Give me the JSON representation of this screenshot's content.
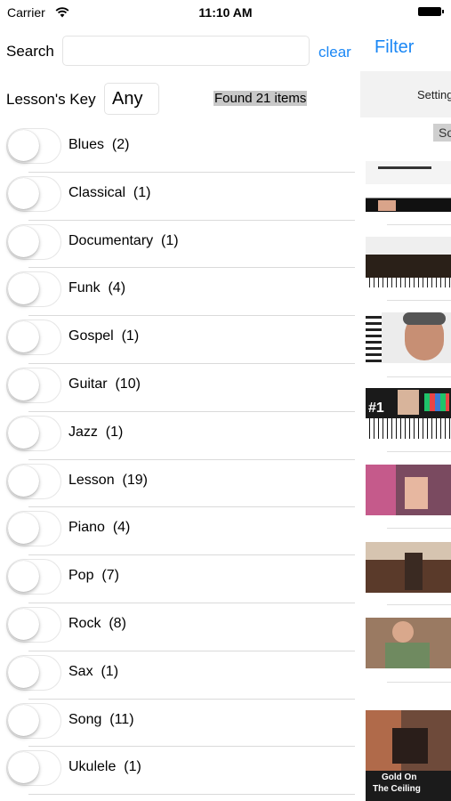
{
  "status_bar": {
    "carrier": "Carrier",
    "time": "11:10 AM"
  },
  "search": {
    "label": "Search",
    "value": "",
    "placeholder": "",
    "clear_label": "clear"
  },
  "key": {
    "label": "Lesson's Key",
    "value": "Any"
  },
  "found_text": "Found 21 items",
  "categories": [
    {
      "label": "Blues  (2)",
      "on": false
    },
    {
      "label": "Classical  (1)",
      "on": false
    },
    {
      "label": "Documentary  (1)",
      "on": false
    },
    {
      "label": "Funk  (4)",
      "on": false
    },
    {
      "label": "Gospel  (1)",
      "on": false
    },
    {
      "label": "Guitar  (10)",
      "on": false
    },
    {
      "label": "Jazz  (1)",
      "on": false
    },
    {
      "label": "Lesson  (19)",
      "on": false
    },
    {
      "label": "Piano  (4)",
      "on": false
    },
    {
      "label": "Pop  (7)",
      "on": false
    },
    {
      "label": "Rock  (8)",
      "on": false
    },
    {
      "label": "Sax  (1)",
      "on": false
    },
    {
      "label": "Song  (11)",
      "on": false
    },
    {
      "label": "Ukulele  (1)",
      "on": false
    }
  ],
  "background_view": {
    "filter_label": "Filter",
    "settings_label": "Settings",
    "sort_label": "Sort",
    "thumbnails": [
      {
        "kind": "piano-lesson"
      },
      {
        "kind": "piano-podcast"
      },
      {
        "kind": "man-with-keyboard"
      },
      {
        "kind": "piano-number-one"
      },
      {
        "kind": "guitar-player-pink"
      },
      {
        "kind": "guitar-player-room"
      },
      {
        "kind": "guitar-player-sofa"
      },
      {
        "kind": "guitar-player-red"
      },
      {
        "kind": "gold-on-the-ceiling"
      }
    ],
    "thumbnail_texts": {
      "number_one": "#1",
      "gold_on": "Gold On",
      "the_ceiling": "The Ceiling"
    }
  },
  "colors": {
    "accent": "#1a87f5",
    "found_bg": "#c8c8c8"
  }
}
